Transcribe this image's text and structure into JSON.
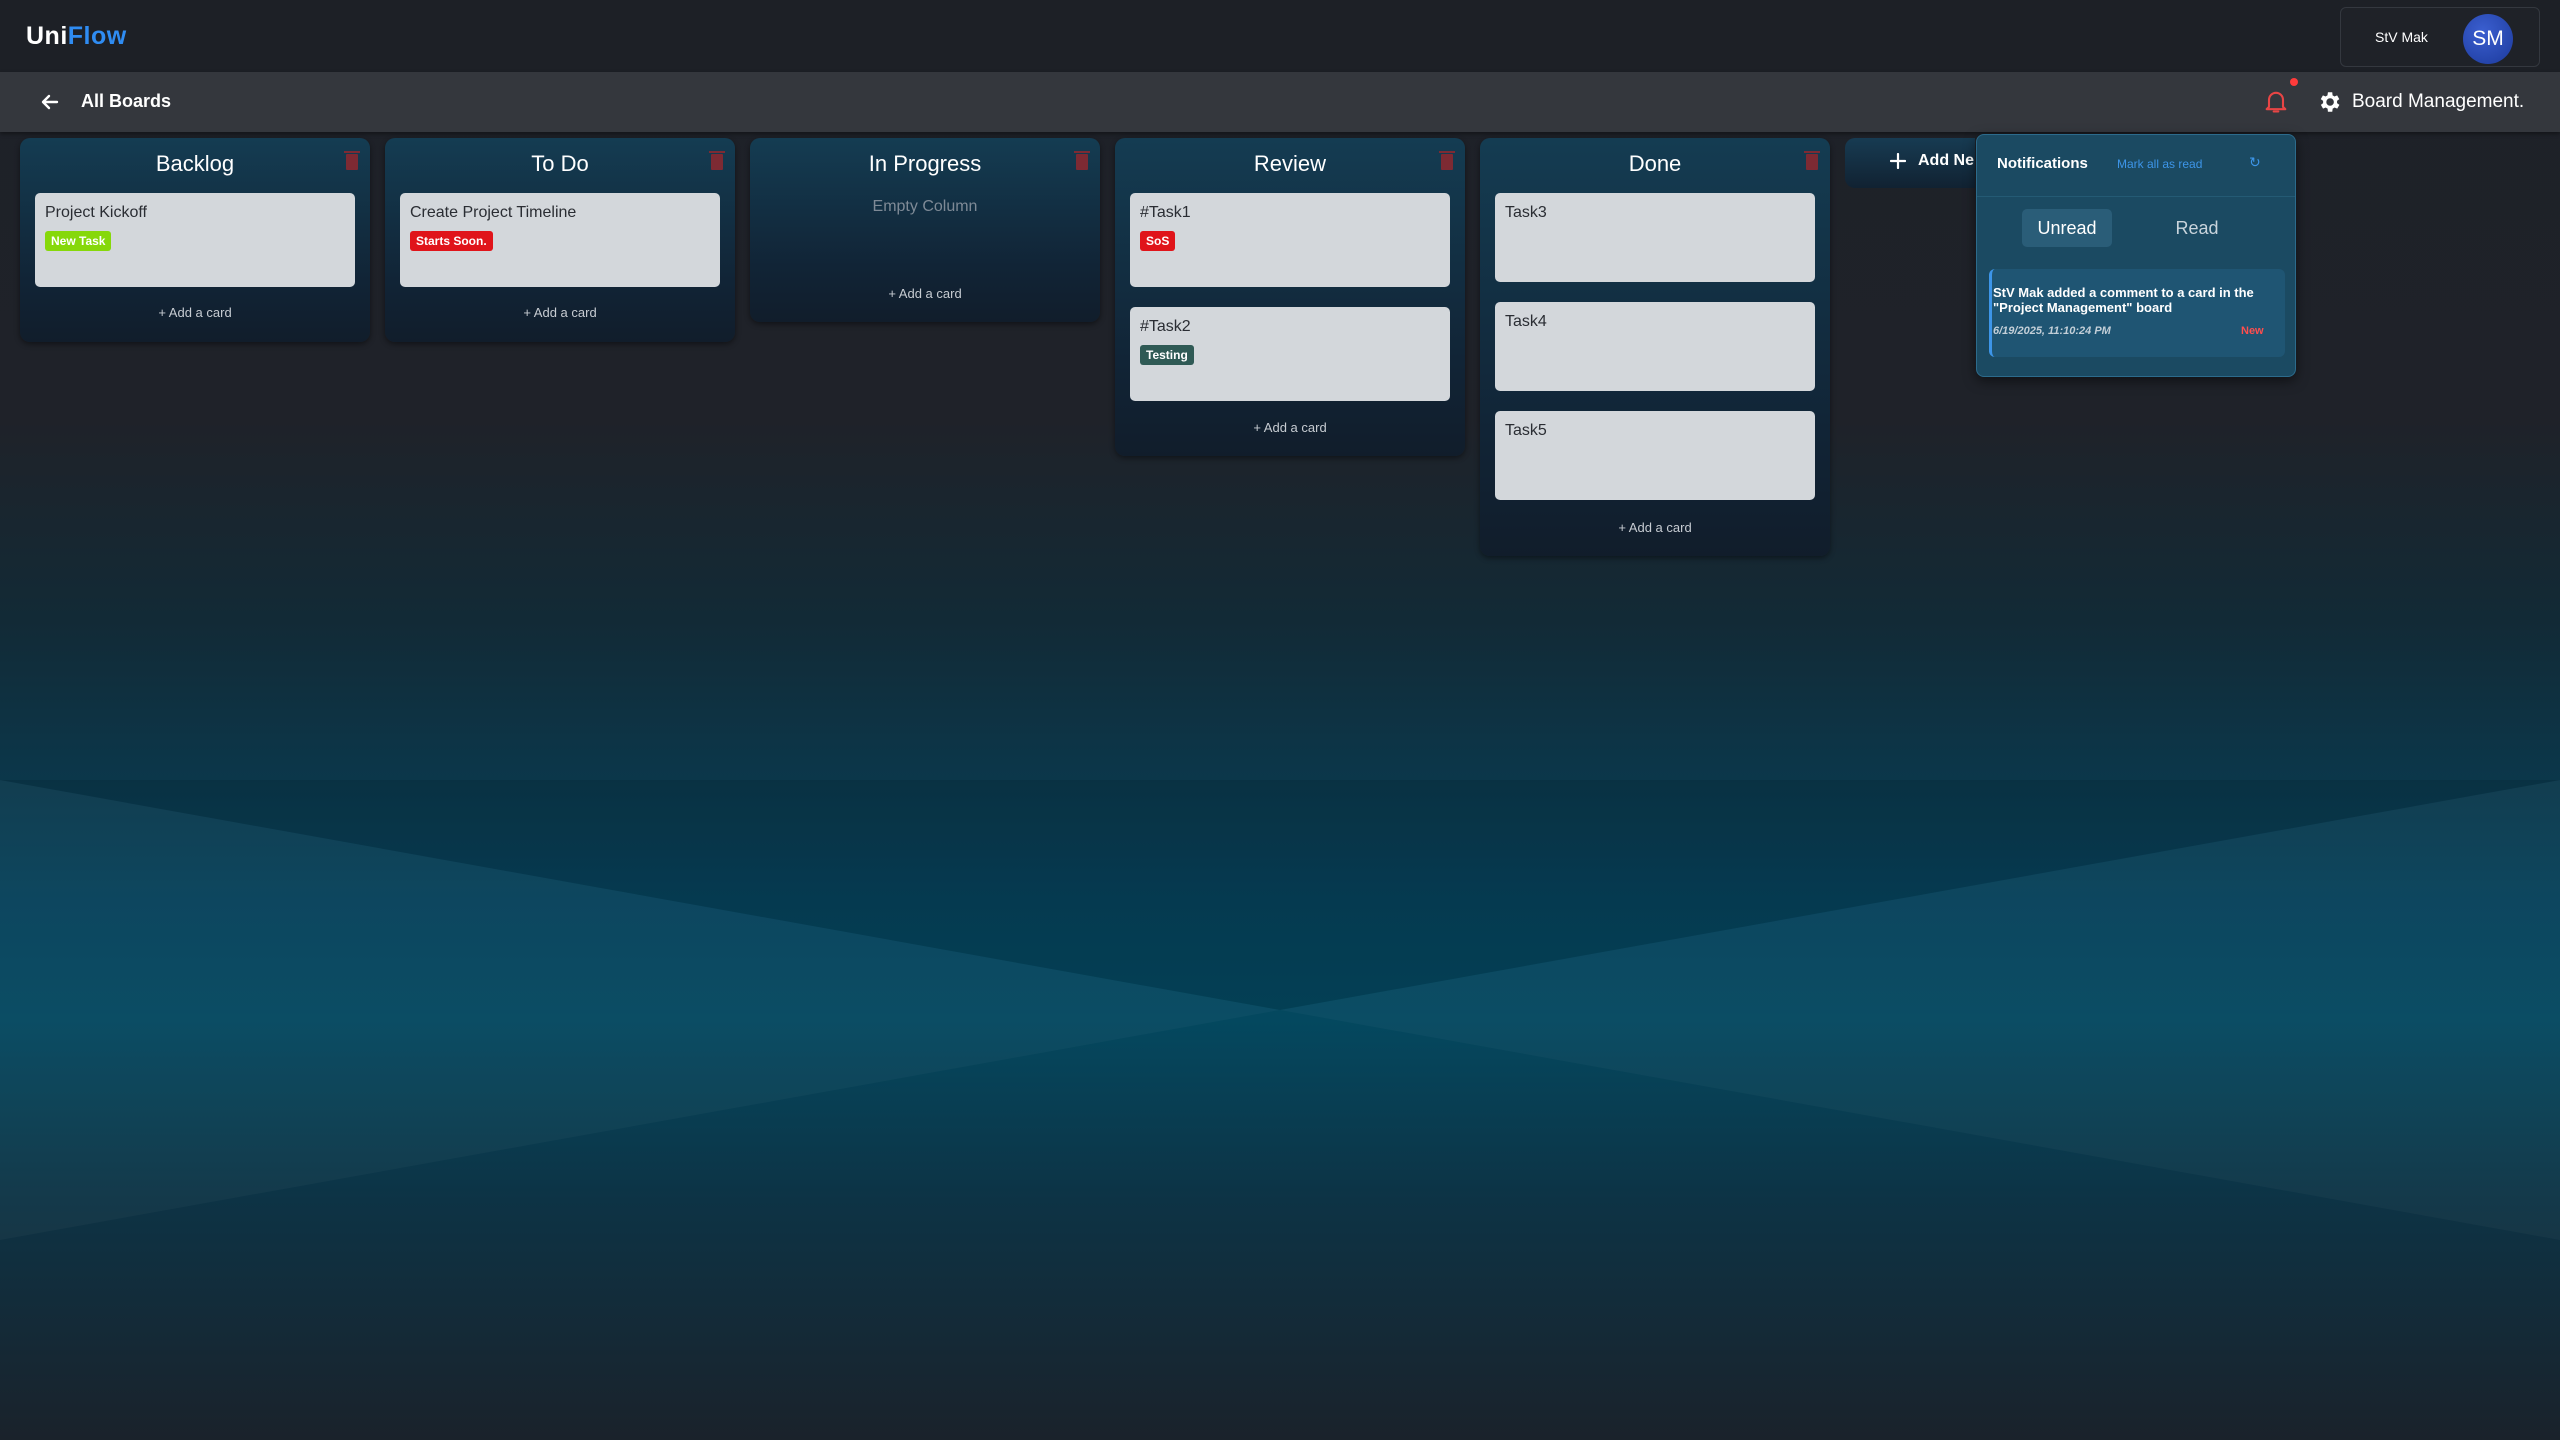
{
  "app": {
    "logo_part1": "Uni",
    "logo_part2": "Flow",
    "accent": "#2f8cf2"
  },
  "user": {
    "name": "StV Mak",
    "initials": "SM"
  },
  "subbar": {
    "back_label": "All Boards",
    "board_name": "Board Management.",
    "bell_icon": "bell-icon",
    "settings_icon": "gear-icon"
  },
  "columns": [
    {
      "title": "Backlog",
      "add_label": "+ Add a card",
      "cards": [
        {
          "title": "Project Kickoff",
          "tag": "New Task",
          "tag_color": "#86d80a"
        }
      ]
    },
    {
      "title": "To Do",
      "add_label": "+ Add a card",
      "cards": [
        {
          "title": "Create Project Timeline",
          "tag": "Starts Soon.",
          "tag_color": "#e0141a"
        }
      ]
    },
    {
      "title": "In Progress",
      "add_label": "+ Add a card",
      "empty_text": "Empty Column",
      "cards": []
    },
    {
      "title": "Review",
      "add_label": "+ Add a card",
      "cards": [
        {
          "title": "#Task1",
          "tag": "SoS",
          "tag_color": "#e0141a"
        },
        {
          "title": "#Task2",
          "tag": "Testing",
          "tag_color": "#2f5a55"
        }
      ]
    },
    {
      "title": "Done",
      "add_label": "+ Add a card",
      "cards": [
        {
          "title": "Task3"
        },
        {
          "title": "Task4"
        },
        {
          "title": "Task5"
        }
      ]
    }
  ],
  "add_list": {
    "label": "Add Ne"
  },
  "notifications": {
    "title": "Notifications",
    "mark_all": "Mark all as read",
    "refresh_icon": "↻",
    "tabs": [
      "Unread",
      "Read"
    ],
    "items": [
      {
        "message": "StV Mak added a comment to a card in the \"Project Management\" board",
        "time": "6/19/2025, 11:10:24 PM",
        "badge": "New"
      }
    ]
  }
}
